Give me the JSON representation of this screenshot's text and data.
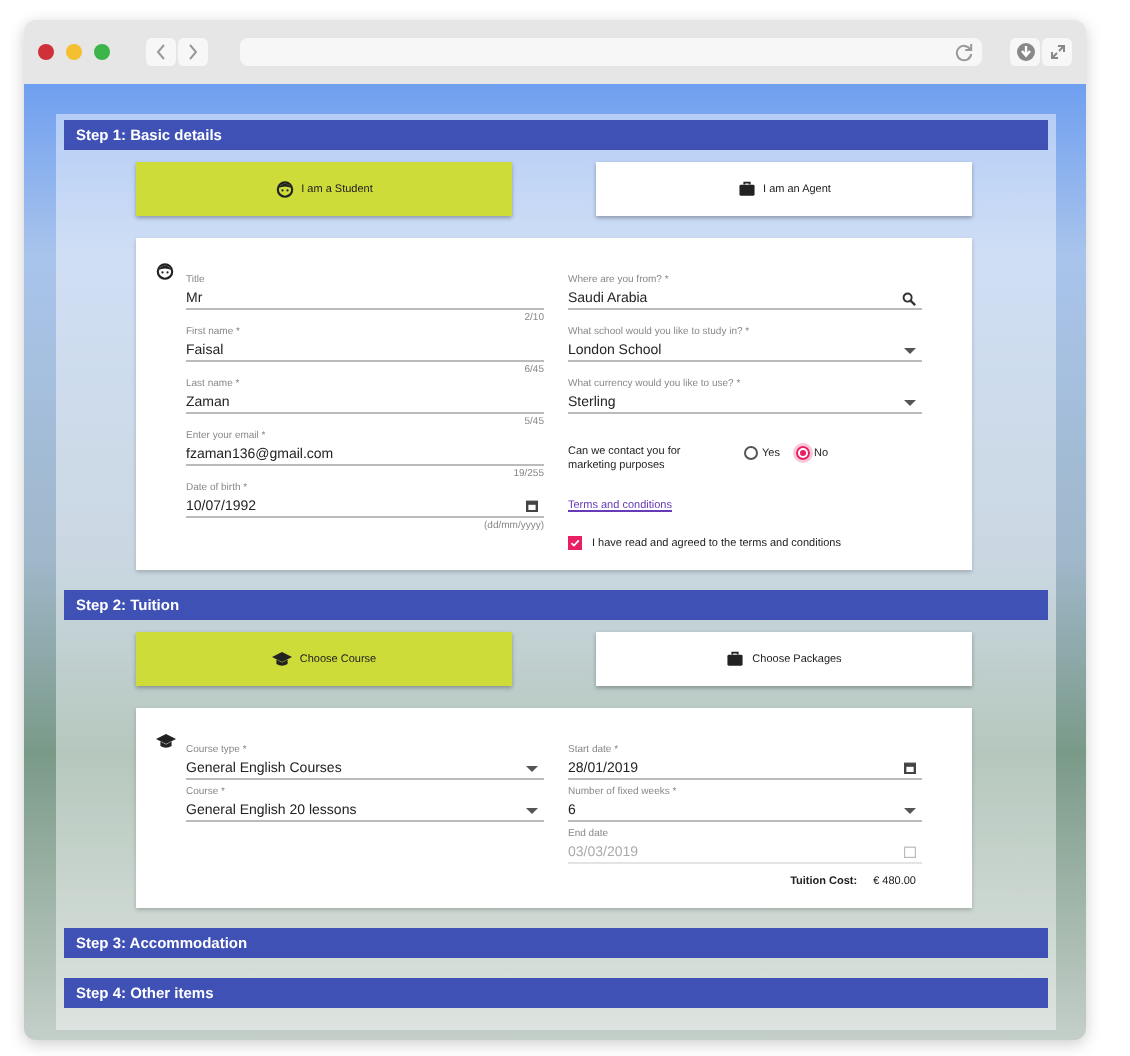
{
  "steps": [
    {
      "title": "Step 1: Basic details",
      "choices": [
        {
          "label": "I am a Student",
          "kind": "student",
          "selected": true
        },
        {
          "label": "I am an Agent",
          "kind": "briefcase",
          "selected": false
        }
      ],
      "card": {
        "kind": "student",
        "left": [
          {
            "label": "Title",
            "value": "Mr",
            "kind": "text",
            "hint": "2/10",
            "disabled": false
          },
          {
            "label": "First name *",
            "value": "Faisal",
            "kind": "text",
            "hint": "6/45",
            "disabled": false
          },
          {
            "label": "Last name *",
            "value": "Zaman",
            "kind": "text",
            "hint": "5/45",
            "disabled": false
          },
          {
            "label": "Enter your email *",
            "value": "fzaman136@gmail.com",
            "kind": "text",
            "hint": "19/255",
            "disabled": false
          },
          {
            "label": "Date of birth *",
            "value": "10/07/1992",
            "kind": "date",
            "hint": "(dd/mm/yyyy)",
            "disabled": false
          }
        ],
        "right": [
          {
            "label": "Where are you from? *",
            "value": "Saudi Arabia",
            "kind": "search",
            "disabled": false
          },
          {
            "label": "What school would you like to study in? *",
            "value": "London School",
            "kind": "select",
            "disabled": false
          },
          {
            "label": "What currency would you like to use? *",
            "value": "Sterling",
            "kind": "select",
            "disabled": false
          }
        ],
        "marketing": {
          "question": "Can we contact you for marketing purposes",
          "options": [
            {
              "label": "Yes",
              "selected": false
            },
            {
              "label": "No",
              "selected": true
            }
          ]
        },
        "terms_link": "Terms and conditions",
        "agreement": {
          "label": "I have read and agreed to the terms and conditions",
          "checked": true
        }
      }
    },
    {
      "title": "Step 2: Tuition",
      "choices": [
        {
          "label": "Choose Course",
          "kind": "cap",
          "selected": true
        },
        {
          "label": "Choose Packages",
          "kind": "briefcase",
          "selected": false
        }
      ],
      "card": {
        "kind": "cap",
        "left": [
          {
            "label": "Course type *",
            "value": "General English Courses",
            "kind": "select",
            "disabled": false
          },
          {
            "label": "Course *",
            "value": "General English 20 lessons",
            "kind": "select",
            "disabled": false
          }
        ],
        "right": [
          {
            "label": "Start date *",
            "value": "28/01/2019",
            "kind": "date",
            "disabled": false
          },
          {
            "label": "Number of fixed weeks *",
            "value": "6",
            "kind": "select",
            "disabled": false
          },
          {
            "label": "End date",
            "value": "03/03/2019",
            "kind": "date",
            "disabled": true
          }
        ],
        "total": {
          "label": "Tuition Cost:",
          "value": "€ 480.00"
        }
      }
    },
    {
      "title": "Step 3: Accommodation"
    },
    {
      "title": "Step 4: Other items"
    }
  ]
}
